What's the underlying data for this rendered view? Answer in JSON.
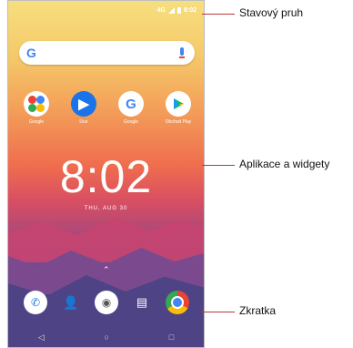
{
  "status_bar": {
    "network": "4G",
    "time": "8:02"
  },
  "search": {
    "logo": "G"
  },
  "apps": [
    {
      "name": "Google",
      "icon": "folder-icon"
    },
    {
      "name": "Duo",
      "icon": "duo-icon"
    },
    {
      "name": "Google",
      "icon": "google-icon"
    },
    {
      "name": "Obchod Play",
      "icon": "play-store-icon"
    }
  ],
  "clock": {
    "time": "8:02",
    "date": "THU, AUG 30"
  },
  "dock": [
    "phone-icon",
    "contacts-icon",
    "camera-icon",
    "messages-icon",
    "chrome-icon"
  ],
  "annotations": {
    "status_bar": "Stavový pruh",
    "apps_widgets": "Aplikace a widgety",
    "shortcut": "Zkratka"
  },
  "nav": {
    "back": "◁",
    "home": "○",
    "recents": "□"
  },
  "colors": {
    "callout_line": "#b83a3a"
  }
}
